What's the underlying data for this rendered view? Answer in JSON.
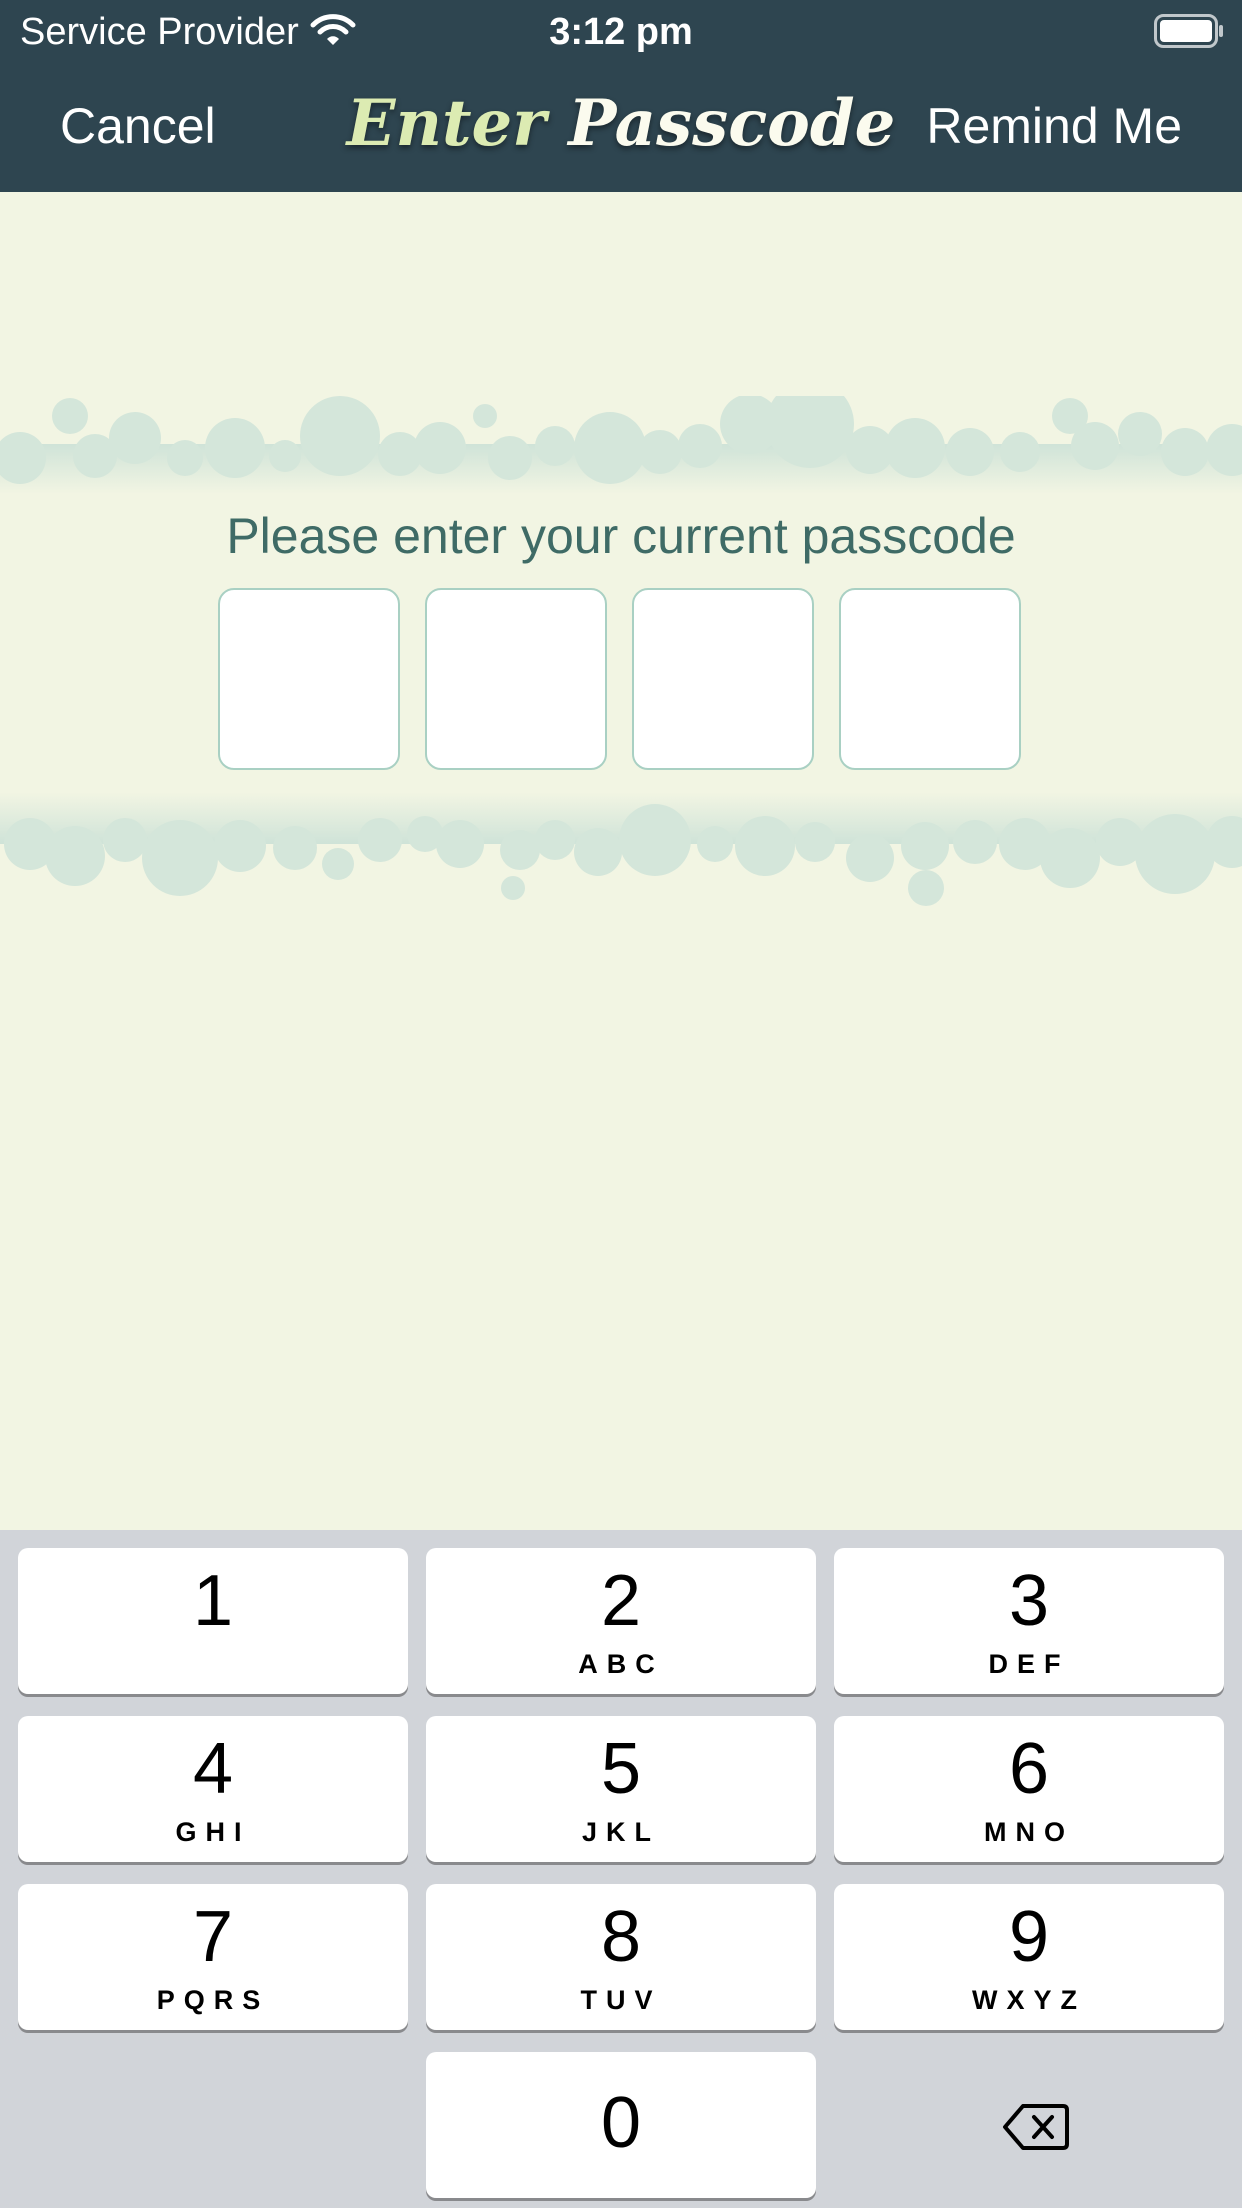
{
  "status_bar": {
    "carrier": "Service Provider",
    "time": "3:12 pm",
    "wifi_icon": "wifi-icon",
    "battery_icon": "battery-icon"
  },
  "nav": {
    "cancel_label": "Cancel",
    "title_first": "Enter",
    "title_second": "Passcode",
    "remind_label": "Remind Me"
  },
  "passcode": {
    "prompt": "Please enter your current passcode",
    "box_count": 4,
    "entered_digits": ""
  },
  "keypad": {
    "keys": [
      {
        "digit": "1",
        "letters": ""
      },
      {
        "digit": "2",
        "letters": "ABC"
      },
      {
        "digit": "3",
        "letters": "DEF"
      },
      {
        "digit": "4",
        "letters": "GHI"
      },
      {
        "digit": "5",
        "letters": "JKL"
      },
      {
        "digit": "6",
        "letters": "MNO"
      },
      {
        "digit": "7",
        "letters": "PQRS"
      },
      {
        "digit": "8",
        "letters": "TUV"
      },
      {
        "digit": "9",
        "letters": "WXYZ"
      },
      {
        "digit": "0",
        "letters": ""
      }
    ],
    "delete_icon": "delete-backspace-icon"
  },
  "colors": {
    "nav_background": "#2e4550",
    "page_background": "#f2f5e3",
    "cloud": "#cfe3d8",
    "prompt_text": "#3f6b66",
    "box_border": "#a9d0c3",
    "keypad_background": "#d1d4d9"
  }
}
